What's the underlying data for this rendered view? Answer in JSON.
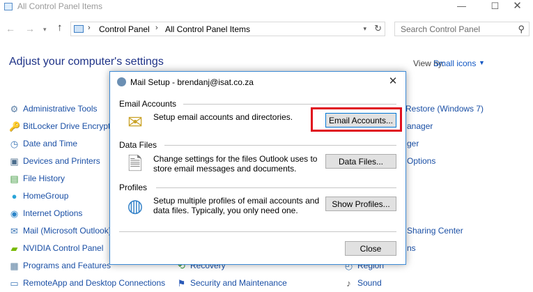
{
  "window": {
    "title": "All Control Panel Items",
    "min_glyph": "—",
    "max_glyph": "☐",
    "close_glyph": "✕"
  },
  "address": {
    "back_glyph": "←",
    "forward_glyph": "→",
    "recent_glyph": "▾",
    "up_glyph": "↑",
    "sep_glyph": "›",
    "crumbs": [
      "Control Panel",
      "All Control Panel Items"
    ],
    "dropdown_glyph": "▾",
    "refresh_glyph": "↻"
  },
  "search": {
    "placeholder": "Search Control Panel",
    "icon_glyph": "⚲"
  },
  "page": {
    "heading": "Adjust your computer's settings",
    "view_by_label": "View by:",
    "view_by_value": "Small icons",
    "view_by_caret": "▼"
  },
  "items_left": [
    {
      "label": "Administrative Tools",
      "glyph": "⚙",
      "color": "#5b7fa6"
    },
    {
      "label": "BitLocker Drive Encryption",
      "glyph": "🔑",
      "color": "#c8a02c"
    },
    {
      "label": "Date and Time",
      "glyph": "◷",
      "color": "#3f78b8"
    },
    {
      "label": "Devices and Printers",
      "glyph": "▣",
      "color": "#4a6c8c"
    },
    {
      "label": "File History",
      "glyph": "▤",
      "color": "#3f9a3f"
    },
    {
      "label": "HomeGroup",
      "glyph": "●",
      "color": "#2aa4d8"
    },
    {
      "label": "Internet Options",
      "glyph": "◉",
      "color": "#2a84c8"
    },
    {
      "label": "Mail (Microsoft Outlook)",
      "glyph": "✉",
      "color": "#3f78b8"
    },
    {
      "label": "NVIDIA Control Panel",
      "glyph": "▰",
      "color": "#76b900"
    },
    {
      "label": "Programs and Features",
      "glyph": "▦",
      "color": "#5a7fa0"
    },
    {
      "label": "RemoteApp and Desktop Connections",
      "glyph": "▭",
      "color": "#3f78b8"
    }
  ],
  "items_mid": [
    {
      "label": "Recovery",
      "glyph": "⟲",
      "color": "#3f9a3f"
    },
    {
      "label": "Security and Maintenance",
      "glyph": "⚑",
      "color": "#2a5ab8"
    }
  ],
  "items_right": [
    {
      "label": "Restore (Windows 7)"
    },
    {
      "label": "anager"
    },
    {
      "label": "ger"
    },
    {
      "label": "Options"
    },
    {
      "label": "Sharing Center"
    },
    {
      "label": "ns"
    },
    {
      "label": "Region",
      "glyph": "◴",
      "color": "#3f78b8"
    },
    {
      "label": "Sound",
      "glyph": "♪",
      "color": "#555555"
    }
  ],
  "dialog": {
    "title": "Mail Setup - brendanj@isat.co.za",
    "close_glyph": "✕",
    "email": {
      "label": "Email Accounts",
      "description": "Setup email accounts and directories.",
      "button": "Email Accounts...",
      "icon_glyph": "✉"
    },
    "data": {
      "label": "Data Files",
      "description_line1": "Change settings for the files Outlook uses to",
      "description_line2": "store email messages and documents.",
      "button": "Data Files...",
      "icon_glyph": "🗎"
    },
    "profiles": {
      "label": "Profiles",
      "description_line1": "Setup multiple profiles of email accounts and",
      "description_line2": "data files. Typically, you only need one.",
      "button": "Show Profiles...",
      "icon_glyph": "◍"
    },
    "close_button": "Close"
  },
  "colors": {
    "accent": "#0078d7",
    "highlight": "#e0101e",
    "link": "#1a4fa5",
    "heading": "#1e3287"
  }
}
